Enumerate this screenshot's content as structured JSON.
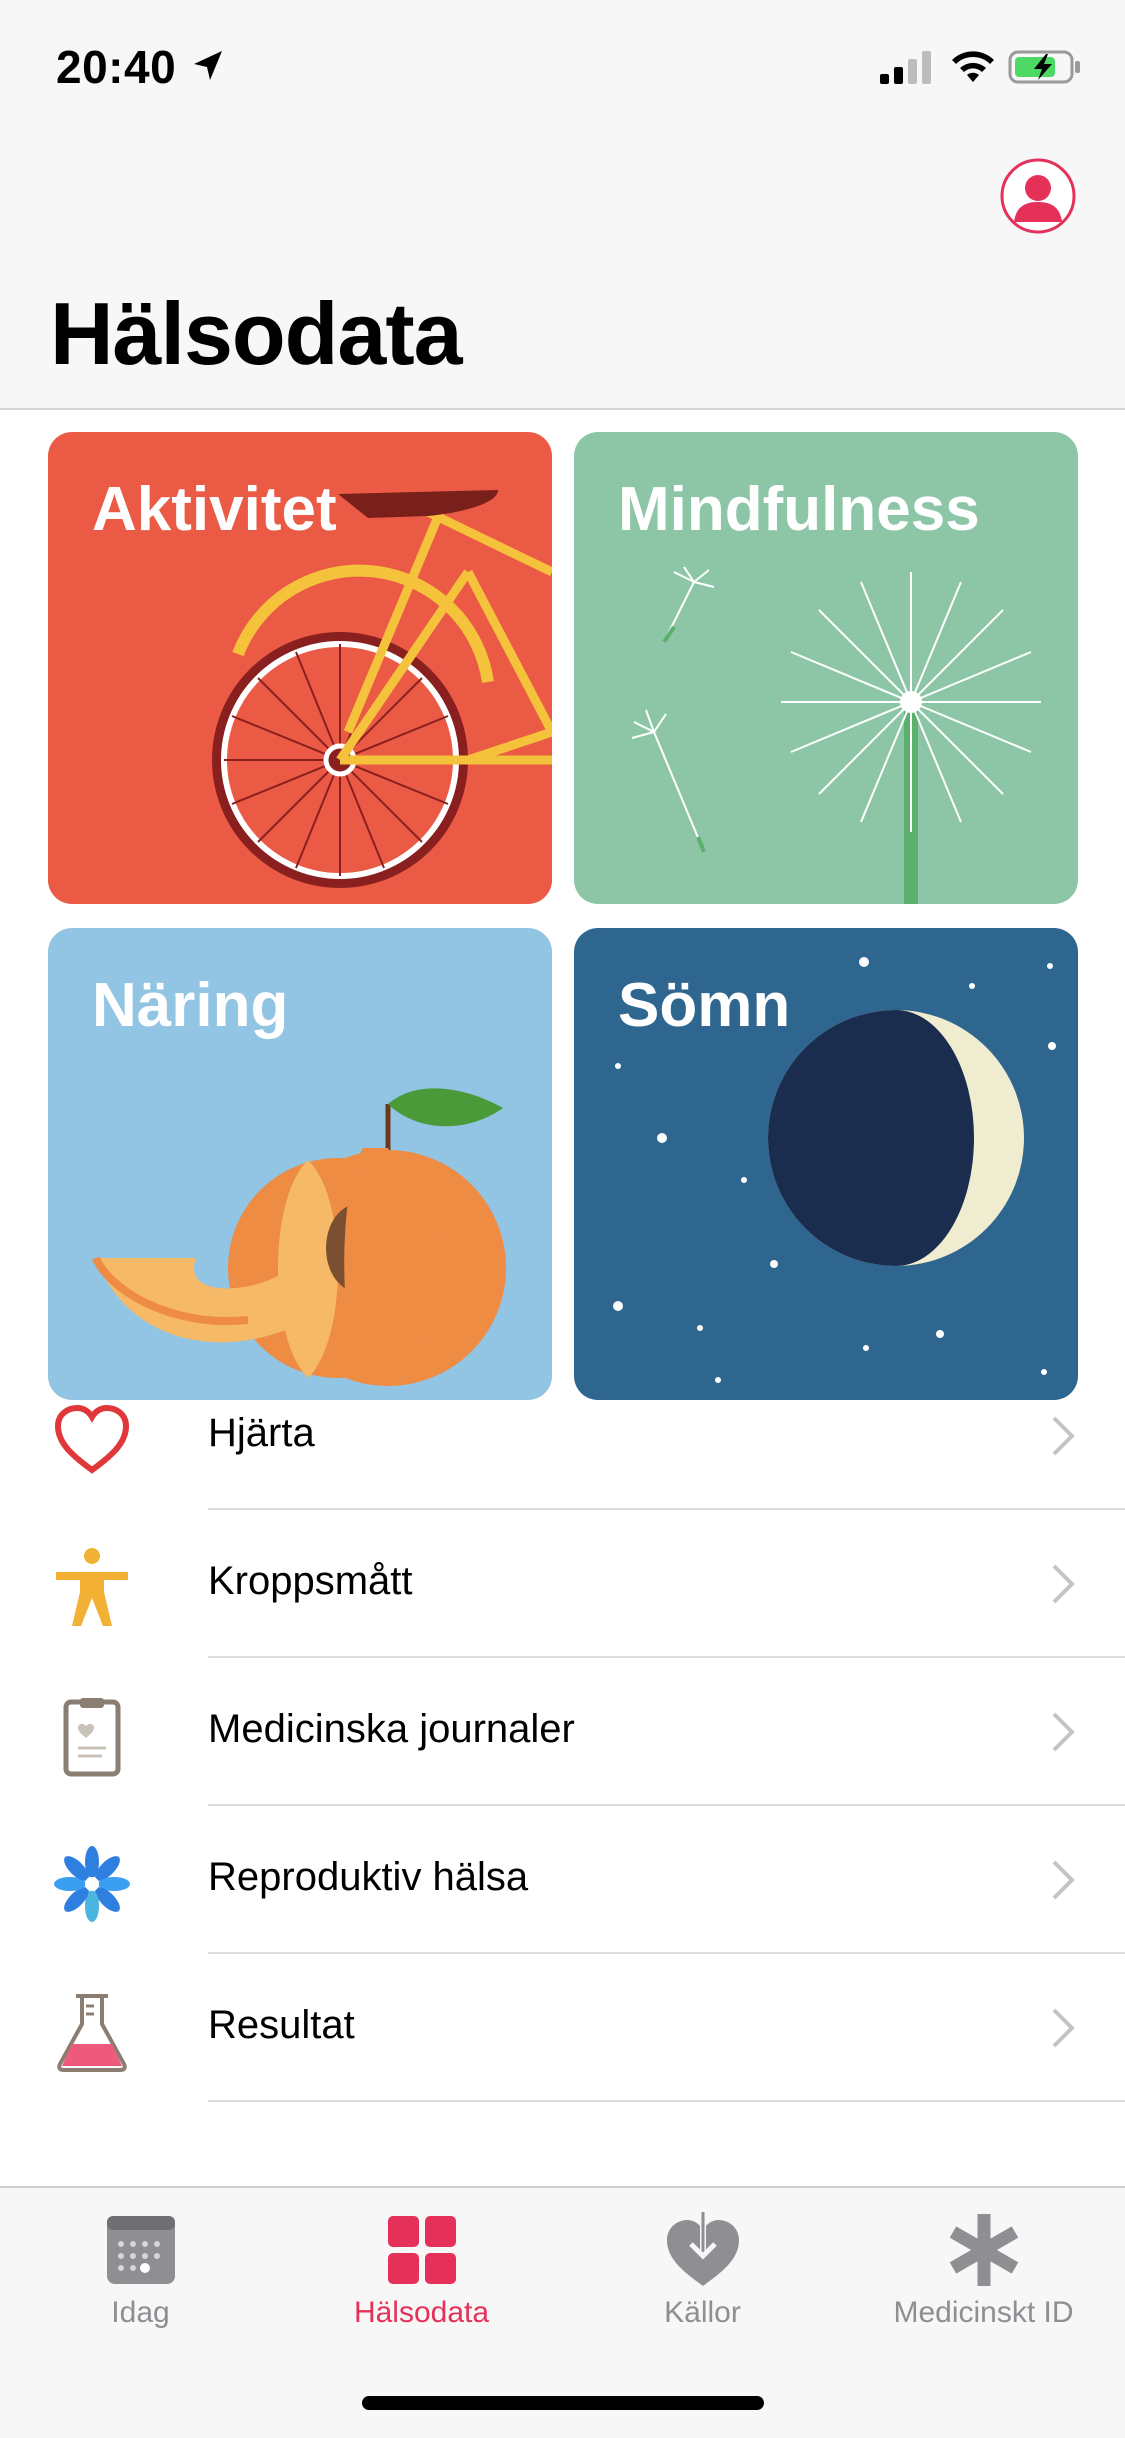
{
  "status_bar": {
    "time": "20:40",
    "icons": [
      "location-arrow-icon",
      "cellular-signal-icon",
      "wifi-icon",
      "battery-charging-icon"
    ]
  },
  "header": {
    "title": "Hälsodata",
    "profile_icon": "profile-avatar-icon"
  },
  "tiles": [
    {
      "label": "Aktivitet",
      "color": "#eb5a45",
      "icon": "bicycle-illustration"
    },
    {
      "label": "Mindfulness",
      "color": "#8cc6a7",
      "icon": "dandelion-illustration"
    },
    {
      "label": "Näring",
      "color": "#92c4e3",
      "icon": "peach-illustration"
    },
    {
      "label": "Sömn",
      "color": "#2e6690",
      "icon": "moon-illustration"
    }
  ],
  "list": [
    {
      "label": "Hjärta",
      "icon": "heart-icon"
    },
    {
      "label": "Kroppsmått",
      "icon": "body-figure-icon"
    },
    {
      "label": "Medicinska journaler",
      "icon": "clipboard-icon"
    },
    {
      "label": "Reproduktiv hälsa",
      "icon": "flower-icon"
    },
    {
      "label": "Resultat",
      "icon": "flask-icon"
    }
  ],
  "tabbar": {
    "tabs": [
      {
        "label": "Idag",
        "icon": "calendar-icon",
        "active": false
      },
      {
        "label": "Hälsodata",
        "icon": "grid-icon",
        "active": true
      },
      {
        "label": "Källor",
        "icon": "heart-download-icon",
        "active": false
      },
      {
        "label": "Medicinskt ID",
        "icon": "asterisk-icon",
        "active": false
      }
    ],
    "active_color": "#e5315a",
    "inactive_color": "#8e8e93"
  }
}
